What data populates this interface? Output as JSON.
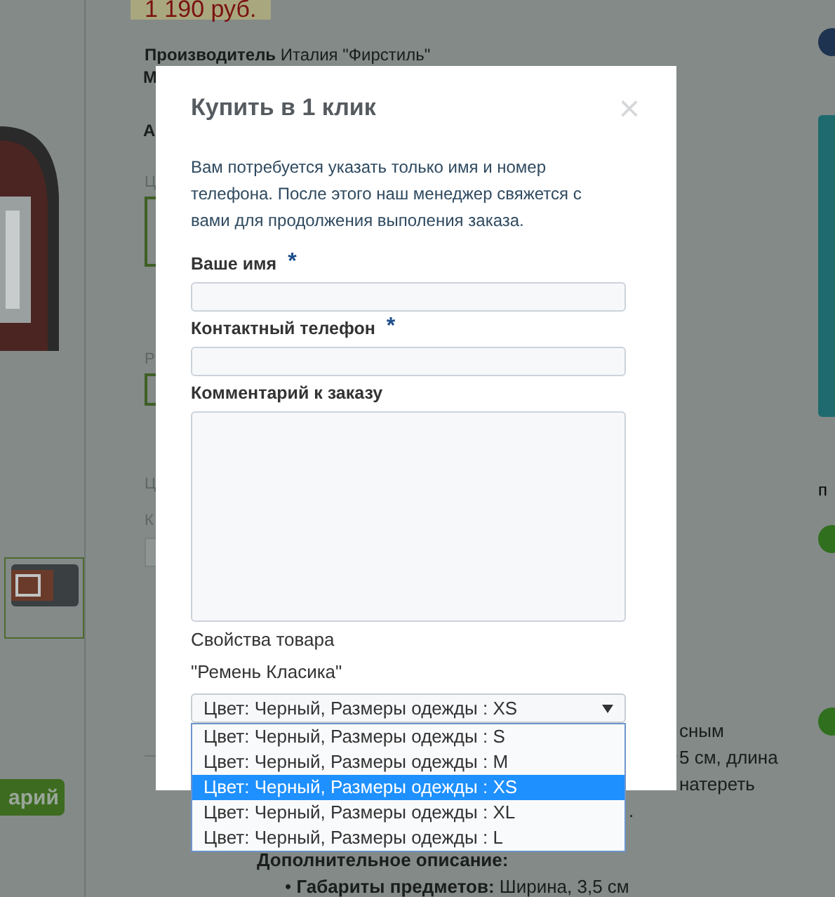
{
  "background": {
    "price": "1 190 руб.",
    "manufacturer_label": "Производитель",
    "manufacturer_value": "Италия \"Фирстиль\"",
    "fragments": [
      {
        "text": "М",
        "kind": "bold"
      },
      {
        "text": "А",
        "kind": "bold"
      },
      {
        "text": "Ц",
        "kind": "muted"
      },
      {
        "text": "Р",
        "kind": "muted"
      },
      {
        "text": "Ц",
        "kind": "muted"
      },
      {
        "text": "К",
        "kind": "muted"
      }
    ],
    "button": "арий",
    "description_lines": [
      "сным",
      "5 см, длина",
      "натереть",
      "."
    ],
    "extra_title": "Дополнительное описание:",
    "extra_items": [
      {
        "bullet": "•",
        "label": "Габариты предметов:",
        "value": "Ширина, 3,5 см"
      }
    ],
    "side_label": "п"
  },
  "modal": {
    "title": "Купить в 1 клик",
    "close": "×",
    "required_mark": "*",
    "intro": "Вам потребуется указать только имя и номер телефона. После этого наш менеджер свяжется с вами для продолжения выполения заказа.",
    "fields": [
      {
        "label": "Ваше имя",
        "required": true,
        "kind": "input"
      },
      {
        "label": "Контактный телефон",
        "required": true,
        "kind": "input"
      },
      {
        "label": "Комментарий к заказу",
        "required": false,
        "kind": "textarea"
      }
    ],
    "properties_title": "Свойства товара",
    "product_name": "\"Ремень Класика\"",
    "select": {
      "value": "Цвет: Черный, Размеры одежды : XS",
      "expanded": true,
      "options": [
        {
          "label": "Цвет: Черный, Размеры одежды : S",
          "selected": false
        },
        {
          "label": "Цвет: Черный, Размеры одежды : M",
          "selected": false
        },
        {
          "label": "Цвет: Черный, Размеры одежды : XS",
          "selected": true
        },
        {
          "label": "Цвет: Черный, Размеры одежды : XL",
          "selected": false
        },
        {
          "label": "Цвет: Черный, Размеры одежды : L",
          "selected": false
        }
      ]
    }
  }
}
